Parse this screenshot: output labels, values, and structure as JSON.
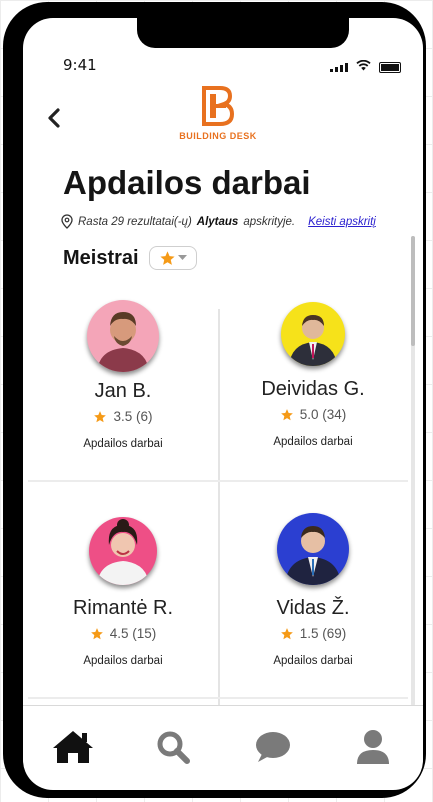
{
  "status_bar": {
    "time": "9:41"
  },
  "header": {
    "back_icon": "chevron-left-icon",
    "logo_text": "BUILDING DESK",
    "brand_color": "#e8711f"
  },
  "page": {
    "title": "Apdailos darbai",
    "location": {
      "results_text": "Rasta 29 rezultatai(-ų)",
      "region": "Alytaus",
      "region_suffix": "apskrityje.",
      "change_link": "Keisti apskritį"
    }
  },
  "section": {
    "title": "Meistrai",
    "filter_icon": "star-icon"
  },
  "workers": [
    {
      "name": "Jan B.",
      "rating": "3.5 (6)",
      "specialty": "Apdailos darbai",
      "avatar_bg": "#f4a5b8"
    },
    {
      "name": "Deividas G.",
      "rating": "5.0 (34)",
      "specialty": "Apdailos darbai",
      "avatar_bg": "#f6e21a"
    },
    {
      "name": "Rimantė R.",
      "rating": "4.5 (15)",
      "specialty": "Apdailos darbai",
      "avatar_bg": "#ee4f86"
    },
    {
      "name": "Vidas Ž.",
      "rating": "1.5 (69)",
      "specialty": "Apdailos darbai",
      "avatar_bg": "#2b3fd1"
    }
  ],
  "nav": [
    "home-icon",
    "search-icon",
    "chat-icon",
    "profile-icon"
  ],
  "colors": {
    "star": "#f59a17",
    "link": "#2a1fcf"
  }
}
